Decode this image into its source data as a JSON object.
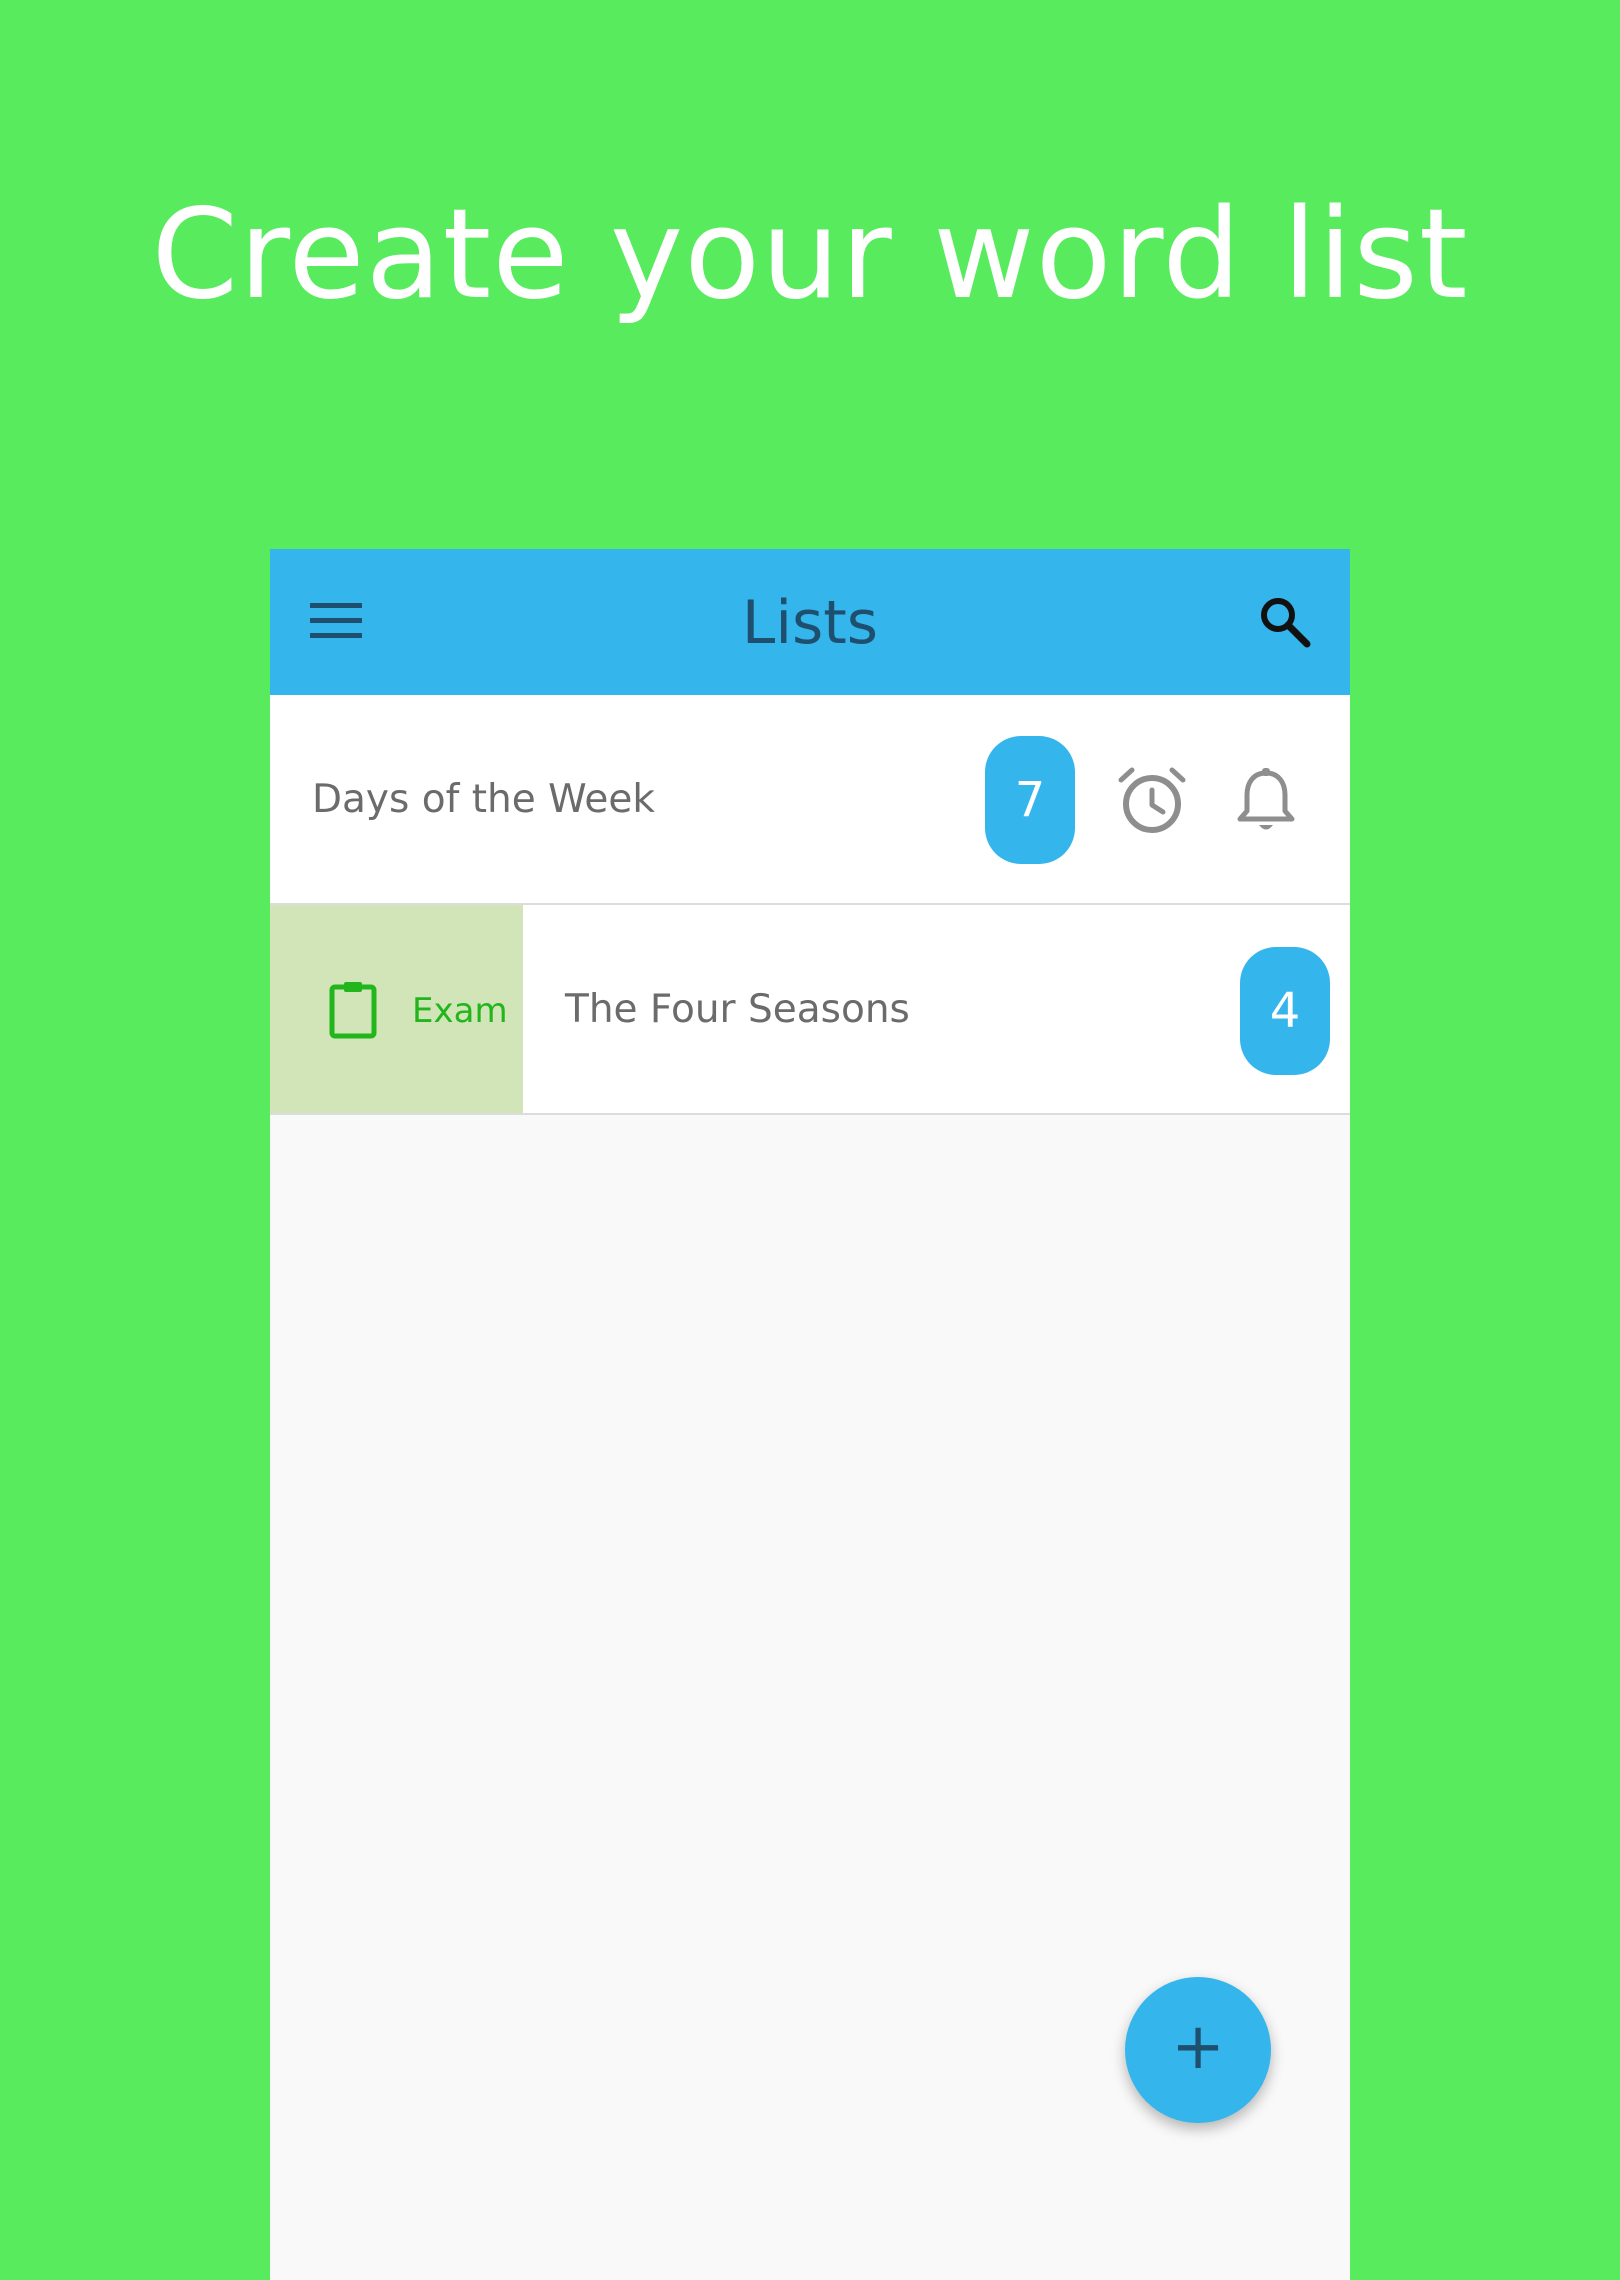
{
  "headline": "Create your word list",
  "app_bar": {
    "title": "Lists",
    "menu_icon": "menu-icon",
    "search_icon": "search-icon",
    "color": "#34B5EC"
  },
  "lists": [
    {
      "title": "Days of the Week",
      "count": "7",
      "icons": [
        "alarm-icon",
        "bell-icon"
      ]
    },
    {
      "title": "The Four Seasons",
      "count": "4",
      "swipe_action": {
        "label": "Exam",
        "icon": "clipboard-icon",
        "color": "#22B61C"
      }
    }
  ],
  "fab": {
    "glyph": "+",
    "icon": "add-icon"
  },
  "colors": {
    "background": "#58EB5E",
    "accent": "#34B5EC",
    "swipe_background": "#D1E5B8"
  }
}
